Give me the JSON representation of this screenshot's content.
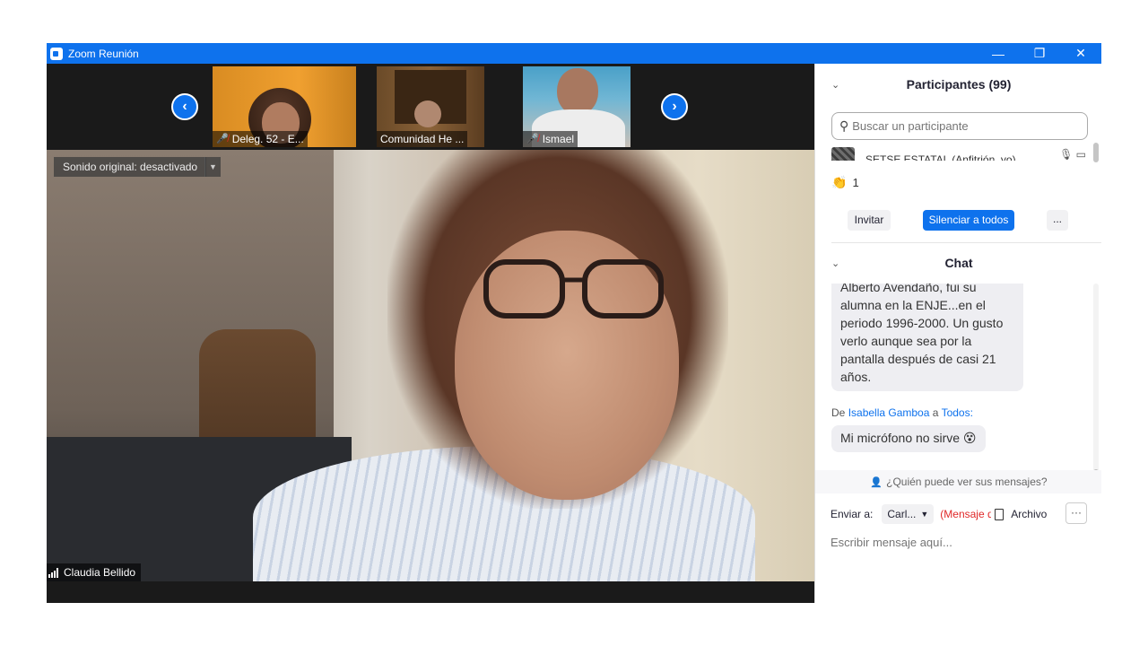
{
  "window": {
    "title": "Zoom Reunión",
    "min_glyph": "—",
    "max_glyph": "❐",
    "close_glyph": "✕"
  },
  "strip": {
    "prev_glyph": "‹",
    "next_glyph": "›",
    "thumbs": [
      {
        "name": "Deleg. 52 - E...",
        "muted": true
      },
      {
        "name": "Comunidad He ...",
        "muted": false
      },
      {
        "name": "Ismael",
        "muted": true
      }
    ]
  },
  "main": {
    "sound_label": "Sonido original: desactivado",
    "sound_drop": "▼",
    "speaker": "Claudia Bellido"
  },
  "participants": {
    "header": "Participantes (99)",
    "search_placeholder": "Buscar un participante",
    "first_row_name": "SETSE ESTATAL (Anfitrión, yo)",
    "reaction_count": "1",
    "invite_label": "Invitar",
    "mute_all_label": "Silenciar a todos",
    "more_label": "..."
  },
  "chat": {
    "header": "Chat",
    "message1": "Alberto Avendaño, fui su alumna en la ENJE...en el periodo 1996-2000. Un gusto verlo aunque sea por la pantalla después de casi 21 años.",
    "meta2": {
      "prefix": "De",
      "from": "Isabella Gamboa",
      "connector": "a",
      "to": "Todos:"
    },
    "message2": "Mi micrófono no sirve 😵",
    "who_sees": "¿Quién puede ver sus mensajes?",
    "send_to_label": "Enviar a:",
    "send_to_value": "Carl...",
    "send_warning": "(Mensaje directo)",
    "file_label": "Archivo",
    "more_label": "···",
    "input_placeholder": "Escribir mensaje aquí..."
  },
  "colors": {
    "accent": "#0e72ed",
    "muted": "#e02828"
  }
}
